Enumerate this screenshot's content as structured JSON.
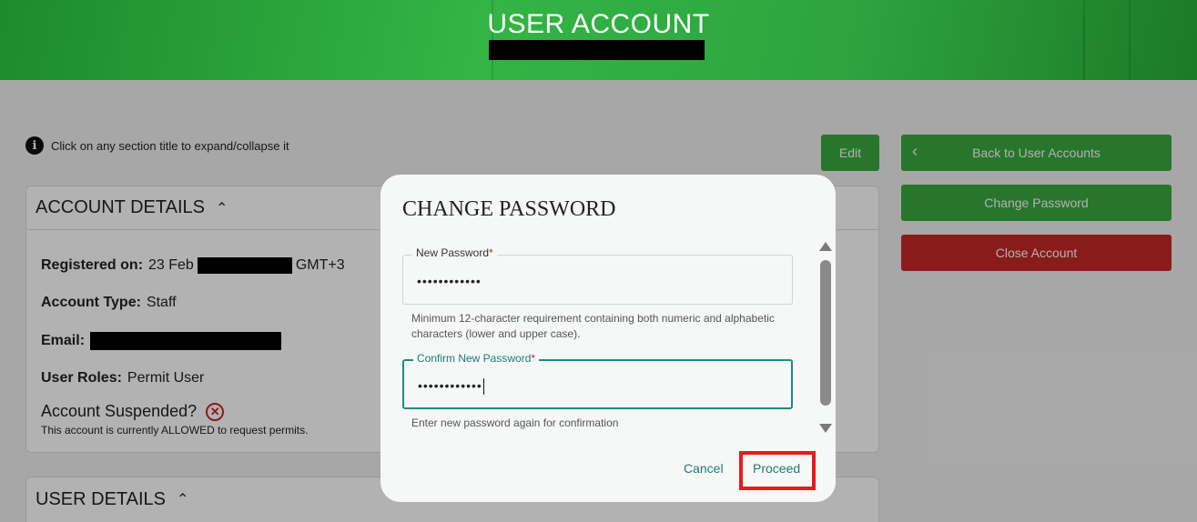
{
  "header": {
    "title": "USER ACCOUNT"
  },
  "info": {
    "text": "Click on any section title to expand/collapse it"
  },
  "actions": {
    "edit": "Edit",
    "back": "Back to User Accounts",
    "change_password": "Change Password",
    "close_account": "Close Account"
  },
  "account_details": {
    "title": "ACCOUNT DETAILS",
    "registered_label": "Registered on:",
    "registered_value_prefix": "23 Feb",
    "registered_value_suffix": "GMT+3",
    "account_type_label": "Account Type:",
    "account_type_value": "Staff",
    "email_label": "Email:",
    "roles_label": "User Roles:",
    "roles_value": "Permit User",
    "suspended_label": "Account Suspended?",
    "suspended_note": "This account is currently ALLOWED to request permits."
  },
  "user_details": {
    "title": "USER DETAILS"
  },
  "modal": {
    "title": "CHANGE PASSWORD",
    "new_password": {
      "label": "New Password",
      "required_mark": "*",
      "value": "••••••••••••",
      "hint": "Minimum 12-character requirement containing both numeric and alphabetic characters (lower and upper case)."
    },
    "confirm_password": {
      "label": "Confirm New Password",
      "required_mark": "*",
      "value": "••••••••••••",
      "hint": "Enter new password again for confirmation"
    },
    "cancel": "Cancel",
    "proceed": "Proceed"
  },
  "colors": {
    "green": "#3aa840",
    "red": "#c62828",
    "teal": "#1e7a75",
    "highlight": "#e51c1c"
  }
}
